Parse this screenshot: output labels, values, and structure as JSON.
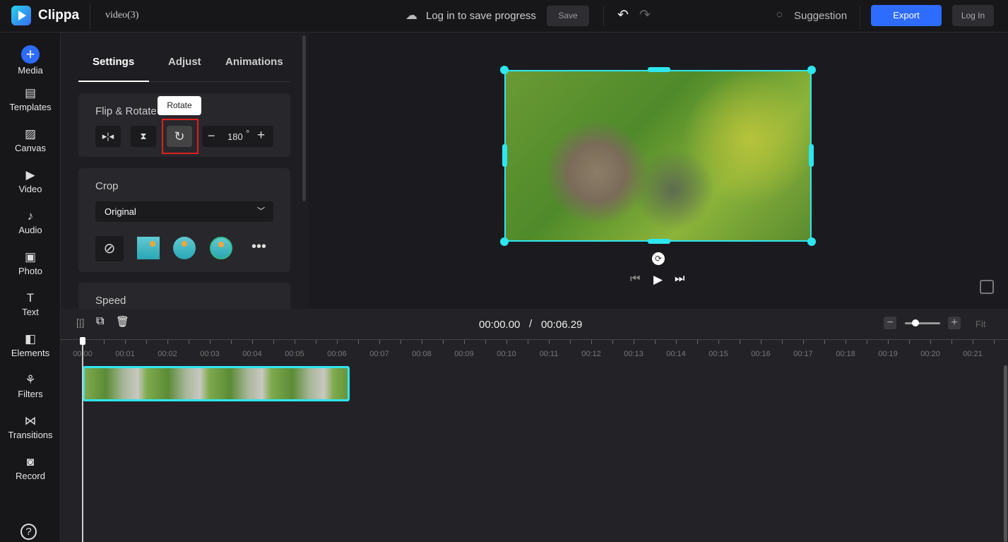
{
  "header": {
    "app_name": "Clippa",
    "project_name": "video(3)",
    "login_prompt": "Log in to save progress",
    "save_label": "Save",
    "suggestion_label": "Suggestion",
    "export_label": "Export",
    "login_label": "Log In"
  },
  "sidebar": {
    "items": [
      {
        "label": "Media",
        "icon": "plus-icon"
      },
      {
        "label": "Templates",
        "icon": "templates-icon"
      },
      {
        "label": "Canvas",
        "icon": "canvas-icon"
      },
      {
        "label": "Video",
        "icon": "video-icon"
      },
      {
        "label": "Audio",
        "icon": "audio-icon"
      },
      {
        "label": "Photo",
        "icon": "photo-icon"
      },
      {
        "label": "Text",
        "icon": "text-icon"
      },
      {
        "label": "Elements",
        "icon": "elements-icon"
      },
      {
        "label": "Filters",
        "icon": "filters-icon"
      },
      {
        "label": "Transitions",
        "icon": "transitions-icon"
      },
      {
        "label": "Record",
        "icon": "record-icon"
      }
    ]
  },
  "panel": {
    "tabs": [
      "Settings",
      "Adjust",
      "Animations"
    ],
    "active_tab": "Settings",
    "flip_rotate": {
      "title": "Flip & Rotate",
      "tooltip": "Rotate",
      "angle": "180",
      "degree": "°"
    },
    "crop": {
      "title": "Crop",
      "selected": "Original"
    },
    "speed": {
      "title": "Speed"
    }
  },
  "timeline": {
    "current_time": "00:00.00",
    "separator": "/",
    "total_time": "00:06.29",
    "fit_label": "Fit",
    "zoom_level": 0.3,
    "ticks": [
      "00:00",
      "00:01",
      "00:02",
      "00:03",
      "00:04",
      "00:05",
      "00:06",
      "00:07",
      "00:08",
      "00:09",
      "00:10",
      "00:11",
      "00:12",
      "00:13",
      "00:14",
      "00:15",
      "00:16",
      "00:17",
      "00:18",
      "00:19",
      "00:20",
      "00:21"
    ]
  },
  "colors": {
    "accent": "#2e6bff",
    "selection": "#2ee6f0",
    "highlight": "#e02020"
  }
}
